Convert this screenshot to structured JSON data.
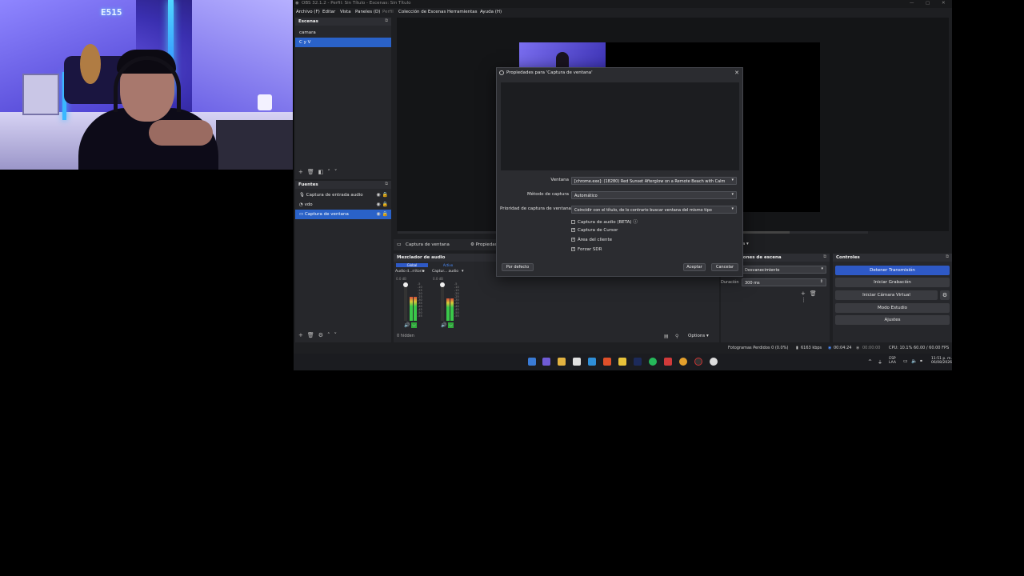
{
  "webcam": {
    "clock_text": "E515"
  },
  "obs": {
    "title": "OBS 32.1.2 - Perfil: Sin Título - Escenas: Sin Título",
    "window_controls": [
      "—",
      "▢",
      "✕"
    ],
    "menu": [
      "Archivo (F)",
      "Editar",
      "Vista",
      "Paneles (D)",
      "Perfil",
      "Colección de Escenas",
      "Herramientas",
      "Ayuda (H)"
    ],
    "scenes": {
      "title": "Escenas",
      "items": [
        {
          "label": "camara",
          "selected": false
        },
        {
          "label": "C y V",
          "selected": true
        }
      ]
    },
    "sources": {
      "title": "Fuentes",
      "items": [
        {
          "label": "Captura de entrada audio",
          "icon": "microphone-icon",
          "selected": false
        },
        {
          "label": "vdo",
          "icon": "video-icon",
          "selected": false
        },
        {
          "label": "Captura de ventana",
          "icon": "window-icon",
          "selected": true
        }
      ]
    },
    "source_toolbar": {
      "selected_source": "Captura de ventana",
      "properties_label": "Propiedades"
    },
    "mixer": {
      "title": "Mezclador de audio",
      "tab_global": "Global",
      "tab_active": "Activo",
      "channels": [
        {
          "name": "Audio d...rritorio",
          "db": "0.0 dB",
          "level": 0.55
        },
        {
          "name": "Captur... audio",
          "db": "0.0 dB",
          "level": 0.5
        }
      ],
      "scale": [
        "-5",
        "-10",
        "-15",
        "-20",
        "-25",
        "-30",
        "-35",
        "-40",
        "-45",
        "-50",
        "-55",
        "-60"
      ],
      "hidden": "0 hidden",
      "options_label": "Options"
    },
    "transitions": {
      "title": "Transiciones de escena",
      "transition_value": "Desvanecimiento",
      "duration_label": "Duración",
      "duration_value": "300 ms"
    },
    "controls": {
      "title": "Controles",
      "buttons": [
        "Detener Transmisión",
        "Iniciar Grabación",
        "Iniciar Cámara Virtual",
        "Modo Estudio",
        "Ajustes"
      ]
    },
    "status": {
      "dropped": "Fotogramas Perdidos 0 (0.0%)",
      "bitrate": "6163 kbps",
      "stream_time": "00:04:24",
      "rec_time": "00:00:00",
      "cpu": "CPU: 10.1%",
      "fps": "60.00 / 60.00 FPS"
    },
    "preview_bar": {
      "scale_label": "Reescalado",
      "scale_value": "Fija"
    }
  },
  "dialog": {
    "title": "Propiedades para 'Captura de ventana'",
    "close": "✕",
    "fields": [
      {
        "label": "Ventana",
        "value": "[chrome.exe]: (18280) Red Sunset Afterglow on a Remote Beach with Calm"
      },
      {
        "label": "Método de captura",
        "value": "Automático"
      },
      {
        "label": "Prioridad de captura de ventana",
        "value": "Coincidir con el título, de lo contrario buscar ventana del mismo tipo"
      }
    ],
    "checkboxes": [
      {
        "label": "Captura de audio (BETA)",
        "checked": false
      },
      {
        "label": "Captura de Cursor",
        "checked": true
      },
      {
        "label": "Área del cliente",
        "checked": true
      },
      {
        "label": "Forzar SDR",
        "checked": true
      }
    ],
    "defaults_button": "Por defecto",
    "accept_button": "Aceptar",
    "cancel_button": "Cancelar"
  },
  "taskbar": {
    "lang": "ESP",
    "lang2": "LAA",
    "time": "11:51 p. m.",
    "date": "06/08/2026"
  },
  "colors": {
    "accent": "#2e59c6",
    "selection": "#2a62c8",
    "panel": "#26272b"
  }
}
